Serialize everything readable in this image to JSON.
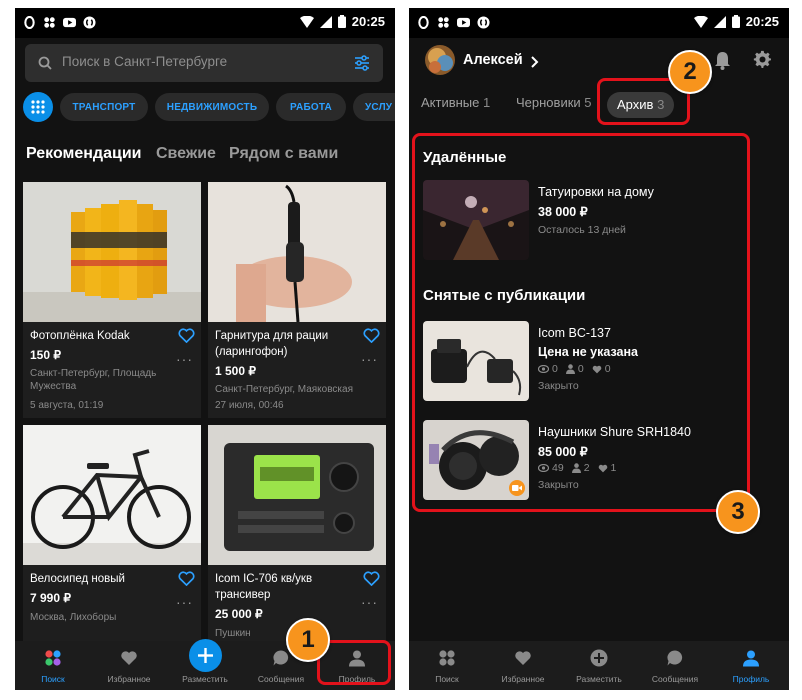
{
  "status_bar": {
    "time": "20:25"
  },
  "left_screen": {
    "search": {
      "placeholder": "Поиск в Санкт-Петербурге"
    },
    "categories": [
      "ТРАНСПОРТ",
      "НЕДВИЖИМОСТЬ",
      "РАБОТА",
      "УСЛУ"
    ],
    "feed_tabs": [
      {
        "label": "Рекомендации",
        "active": true
      },
      {
        "label": "Свежие",
        "active": false
      },
      {
        "label": "Рядом с вами",
        "active": false
      }
    ],
    "cards": [
      {
        "title": "Фотоплёнка Kodak",
        "price": "150 ₽",
        "location": "Санкт-Петербург, Площадь Мужества",
        "date": "5 августа, 01:19"
      },
      {
        "title": "Гарнитура для рации (ларингофон)",
        "price": "1 500 ₽",
        "location": "Санкт-Петербург, Маяковская",
        "date": "27 июля, 00:46"
      },
      {
        "title": "Велосипед новый",
        "price": "7 990 ₽",
        "location": "Москва, Лихоборы",
        "date": ""
      },
      {
        "title": "Icom IC-706 кв/укв трансивер",
        "price": "25 000 ₽",
        "location": "Пушкин",
        "date": ""
      }
    ],
    "bottom_nav": [
      {
        "label": "Поиск",
        "active": true,
        "icon": "search-dots-icon"
      },
      {
        "label": "Избранное",
        "active": false,
        "icon": "heart-icon"
      },
      {
        "label": "Разместить",
        "active": false,
        "icon": "plus-icon"
      },
      {
        "label": "Сообщения",
        "active": false,
        "icon": "chat-icon"
      },
      {
        "label": "Профиль",
        "active": false,
        "icon": "person-icon"
      }
    ]
  },
  "right_screen": {
    "profile_name": "Алексей",
    "tabs": [
      {
        "label": "Активные",
        "count": "1",
        "active": false
      },
      {
        "label": "Черновики",
        "count": "5",
        "active": false
      },
      {
        "label": "Архив",
        "count": "3",
        "active": true
      }
    ],
    "deleted_section": {
      "title": "Удалённые",
      "items": [
        {
          "title": "Татуировки на дому",
          "price": "38 000 ₽",
          "note": "Осталось 13 дней"
        }
      ]
    },
    "unpublished_section": {
      "title": "Снятые с публикации",
      "items": [
        {
          "title": "Icom BC-137",
          "price": "Цена не указана",
          "views": "0",
          "contacts": "0",
          "likes": "0",
          "status": "Закрыто"
        },
        {
          "title": "Наушники Shure SRH1840",
          "price": "85 000 ₽",
          "views": "49",
          "contacts": "2",
          "likes": "1",
          "status": "Закрыто"
        }
      ]
    },
    "bottom_nav": [
      {
        "label": "Поиск",
        "active": false,
        "icon": "search-dots-icon"
      },
      {
        "label": "Избранное",
        "active": false,
        "icon": "heart-icon"
      },
      {
        "label": "Разместить",
        "active": false,
        "icon": "plus-icon"
      },
      {
        "label": "Сообщения",
        "active": false,
        "icon": "chat-icon"
      },
      {
        "label": "Профиль",
        "active": true,
        "icon": "person-icon"
      }
    ]
  },
  "annotations": [
    "1",
    "2",
    "3"
  ],
  "colors": {
    "accent": "#2ca0ff",
    "marker": "#e3121b",
    "badge": "#f7941d"
  }
}
